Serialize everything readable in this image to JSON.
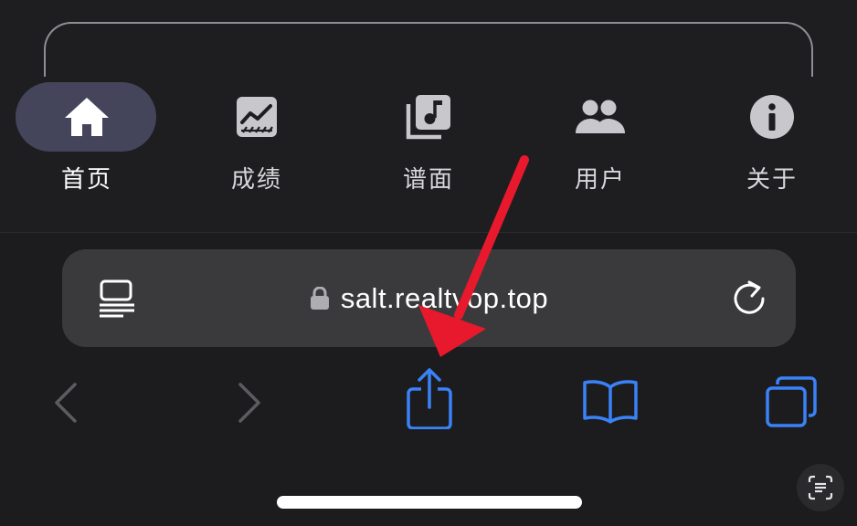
{
  "app_nav": {
    "items": [
      {
        "label": "首页",
        "icon": "home-icon",
        "active": true
      },
      {
        "label": "成绩",
        "icon": "chart-icon",
        "active": false
      },
      {
        "label": "谱面",
        "icon": "music-library-icon",
        "active": false
      },
      {
        "label": "用户",
        "icon": "people-icon",
        "active": false
      },
      {
        "label": "关于",
        "icon": "info-icon",
        "active": false
      }
    ]
  },
  "browser": {
    "url": "salt.realtvop.top",
    "accent_color": "#3a82f7",
    "toolbar": {
      "back": "chevron-left-icon",
      "forward": "chevron-right-icon",
      "share": "share-icon",
      "bookmarks": "book-icon",
      "tabs": "tabs-icon",
      "scan": "text-scan-icon"
    }
  },
  "annotation": {
    "color": "#e8192c",
    "points_to": "share-button"
  }
}
